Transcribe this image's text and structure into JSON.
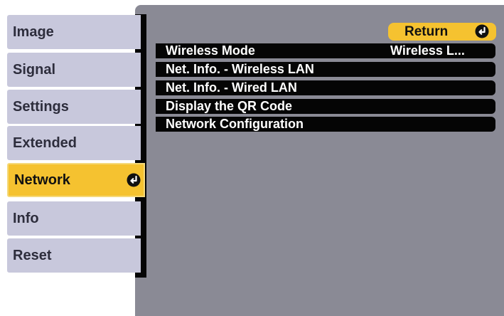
{
  "sidebar": {
    "items": [
      {
        "label": "Image"
      },
      {
        "label": "Signal"
      },
      {
        "label": "Settings"
      },
      {
        "label": "Extended"
      },
      {
        "label": "Network",
        "selected": true
      },
      {
        "label": "Info"
      },
      {
        "label": "Reset"
      }
    ]
  },
  "panel": {
    "return_label": "Return",
    "rows": [
      {
        "label": "Wireless Mode",
        "value": "Wireless L..."
      },
      {
        "label": "Net. Info. - Wireless LAN"
      },
      {
        "label": "Net. Info. - Wired LAN"
      },
      {
        "label": "Display the QR Code"
      },
      {
        "label": "Network Configuration"
      }
    ]
  },
  "colors": {
    "accent": "#f5c230",
    "sidebar_item": "#c8c8dc",
    "panel_bg": "#8a8a95",
    "row_bg": "#050505"
  },
  "icons": {
    "enter": "enter-icon"
  }
}
